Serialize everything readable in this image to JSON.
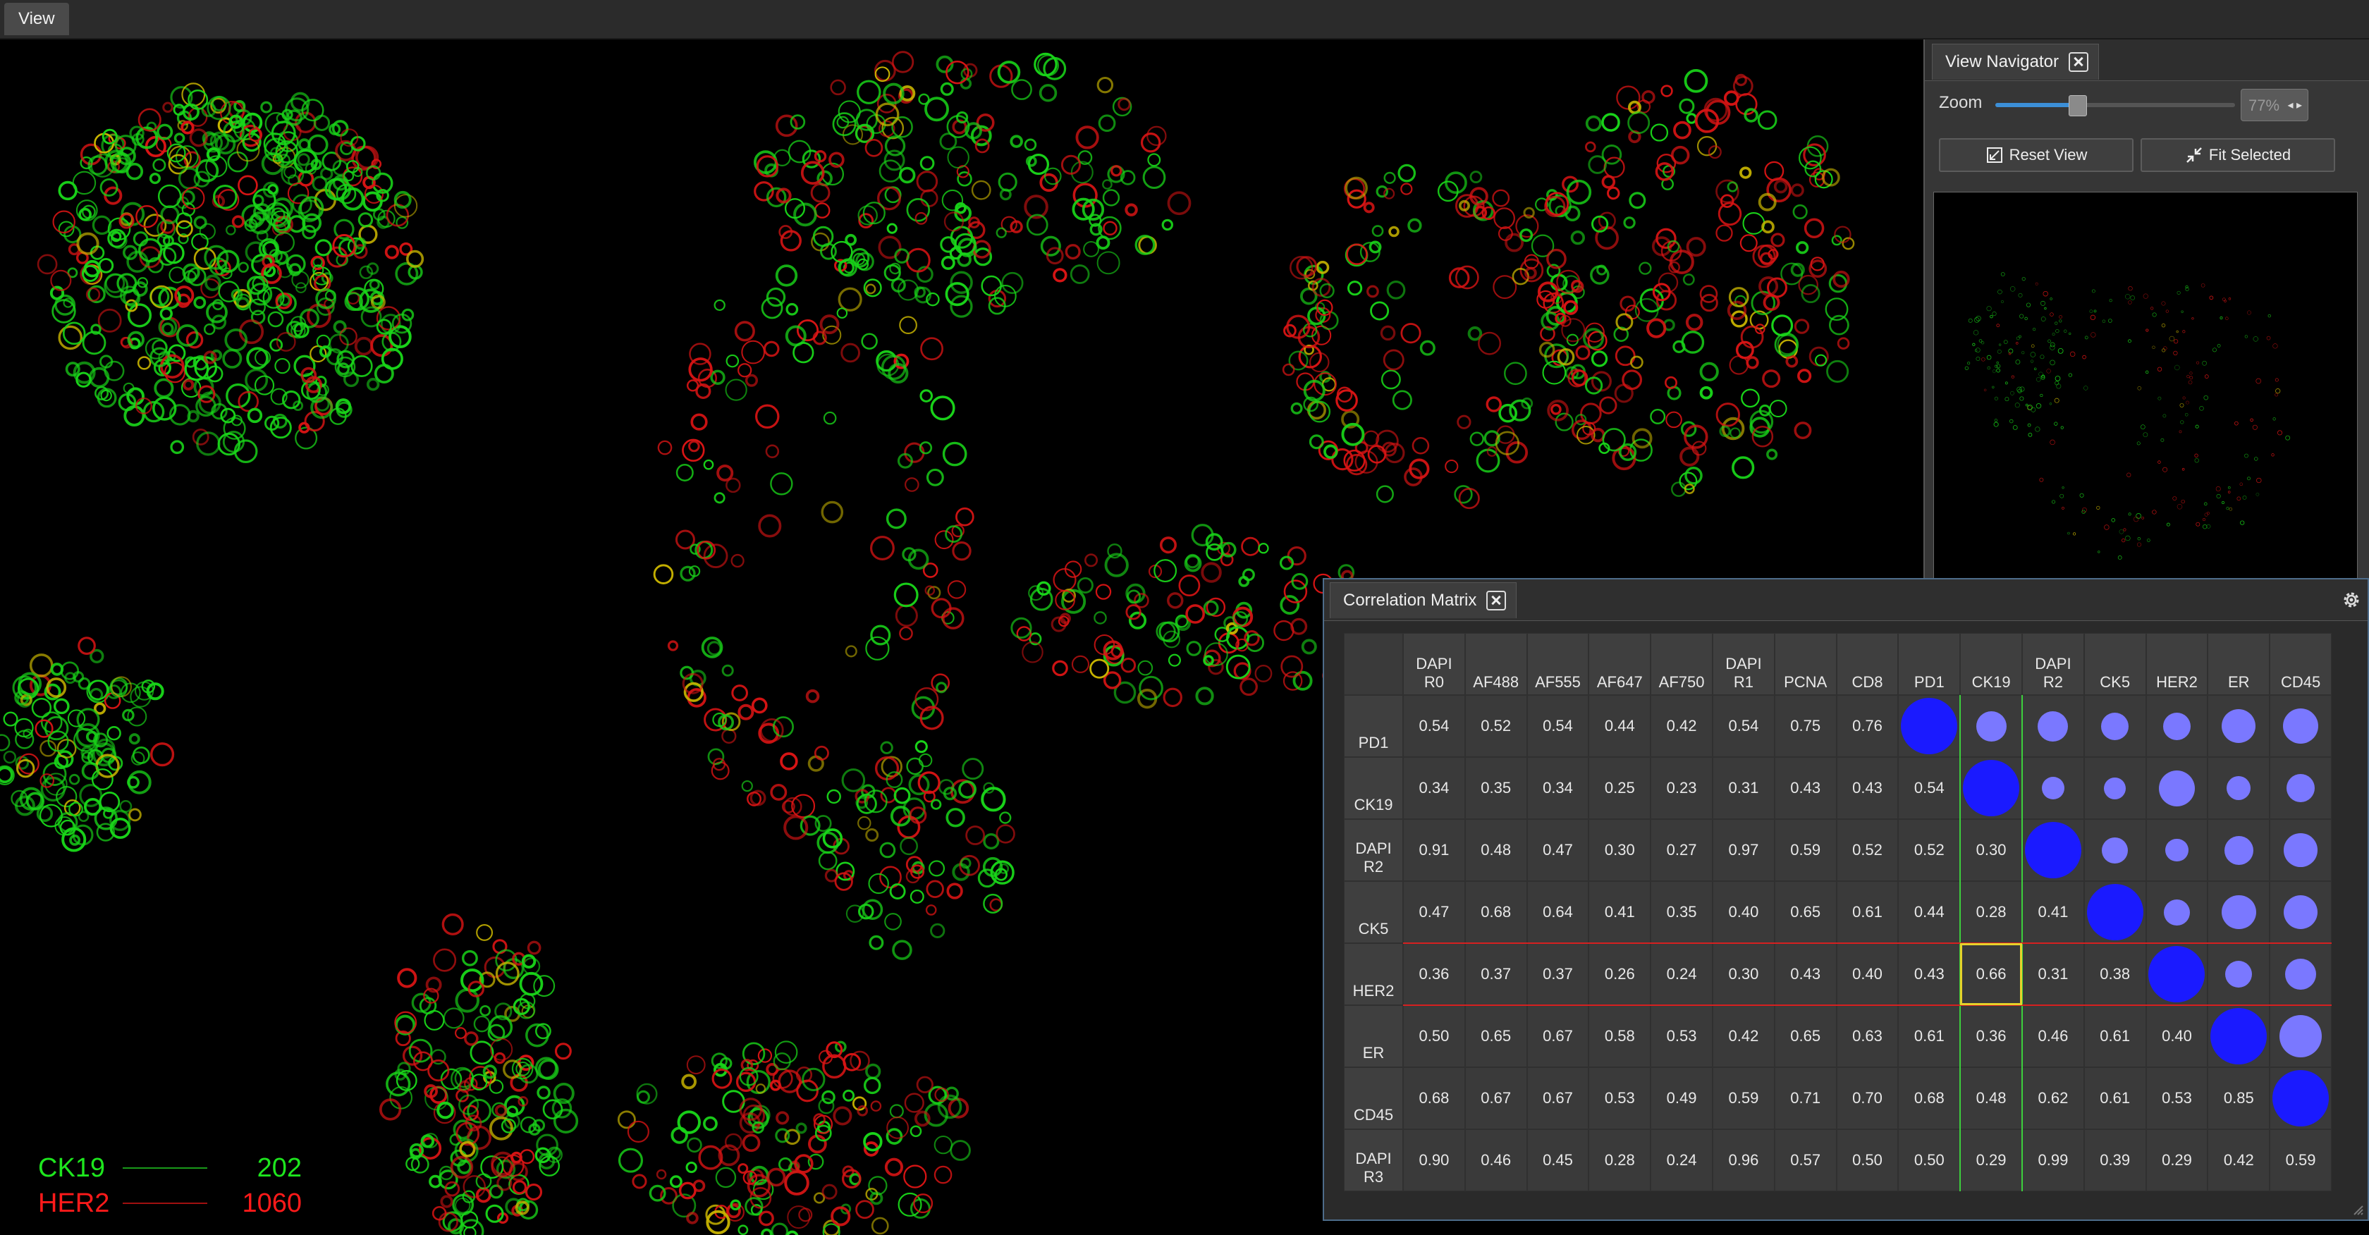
{
  "topbar": {
    "view_tab": "View"
  },
  "legend": [
    {
      "name": "CK19",
      "value": "202",
      "color": "#1ee61e"
    },
    {
      "name": "HER2",
      "value": "1060",
      "color": "#ff1a1a"
    }
  ],
  "navigator": {
    "title": "View Navigator",
    "zoom_label": "Zoom",
    "zoom_value": "77%",
    "zoom_fraction": 0.34,
    "reset_label": "Reset View",
    "fit_label": "Fit Selected"
  },
  "correlation": {
    "title": "Correlation Matrix",
    "columns": [
      [
        "DAPI",
        "R0"
      ],
      [
        "AF488",
        ""
      ],
      [
        "AF555",
        ""
      ],
      [
        "AF647",
        ""
      ],
      [
        "AF750",
        ""
      ],
      [
        "DAPI",
        "R1"
      ],
      [
        "PCNA",
        ""
      ],
      [
        "CD8",
        ""
      ],
      [
        "PD1",
        ""
      ],
      [
        "CK19",
        ""
      ],
      [
        "DAPI",
        "R2"
      ],
      [
        "CK5",
        ""
      ],
      [
        "HER2",
        ""
      ],
      [
        "ER",
        ""
      ],
      [
        "CD45",
        ""
      ]
    ],
    "rows": [
      {
        "label": [
          "PD1",
          ""
        ],
        "values": [
          "0.54",
          "0.52",
          "0.54",
          "0.44",
          "0.42",
          "0.54",
          "0.75",
          "0.76"
        ],
        "dots": [
          1.0,
          0.5,
          0.5,
          0.42,
          0.42,
          0.6,
          0.65
        ]
      },
      {
        "label": [
          "CK19",
          ""
        ],
        "values": [
          "0.34",
          "0.35",
          "0.34",
          "0.25",
          "0.23",
          "0.31",
          "0.43",
          "0.43",
          "0.54"
        ],
        "dots": [
          1.0,
          0.28,
          0.26,
          0.66,
          0.32,
          0.45
        ]
      },
      {
        "label": [
          "DAPI",
          "R2"
        ],
        "values": [
          "0.91",
          "0.48",
          "0.47",
          "0.30",
          "0.27",
          "0.97",
          "0.59",
          "0.52",
          "0.52",
          "0.30"
        ],
        "dots": [
          1.0,
          0.38,
          0.29,
          0.46,
          0.59
        ]
      },
      {
        "label": [
          "CK5",
          ""
        ],
        "values": [
          "0.47",
          "0.68",
          "0.64",
          "0.41",
          "0.35",
          "0.40",
          "0.65",
          "0.61",
          "0.44",
          "0.28",
          "0.41"
        ],
        "dots": [
          1.0,
          0.38,
          0.61,
          0.61
        ]
      },
      {
        "label": [
          "HER2",
          ""
        ],
        "values": [
          "0.36",
          "0.37",
          "0.37",
          "0.26",
          "0.24",
          "0.30",
          "0.43",
          "0.40",
          "0.43",
          "0.66",
          "0.31",
          "0.38"
        ],
        "dots": [
          1.0,
          0.4,
          0.53
        ]
      },
      {
        "label": [
          "ER",
          ""
        ],
        "values": [
          "0.50",
          "0.65",
          "0.67",
          "0.58",
          "0.53",
          "0.42",
          "0.65",
          "0.63",
          "0.61",
          "0.36",
          "0.46",
          "0.61",
          "0.40"
        ],
        "dots": [
          1.0,
          0.85
        ]
      },
      {
        "label": [
          "CD45",
          ""
        ],
        "values": [
          "0.68",
          "0.67",
          "0.67",
          "0.53",
          "0.49",
          "0.59",
          "0.71",
          "0.70",
          "0.68",
          "0.48",
          "0.62",
          "0.61",
          "0.53",
          "0.85"
        ],
        "dots": [
          1.0
        ]
      },
      {
        "label": [
          "DAPI",
          "R3"
        ],
        "values": [
          "0.90",
          "0.46",
          "0.45",
          "0.28",
          "0.24",
          "0.96",
          "0.57",
          "0.50",
          "0.50",
          "0.29",
          "0.99",
          "0.39",
          "0.29",
          "0.42",
          "0.59"
        ],
        "dots": []
      }
    ],
    "highlight_col": 9,
    "highlight_row": 4,
    "dot_color": "#1a1aff",
    "dot_color_light": "#7a78ff"
  },
  "colors": {
    "accent_green": "#3ccf3c",
    "accent_red": "#d62020",
    "highlight_yellow": "#e6d12a"
  }
}
